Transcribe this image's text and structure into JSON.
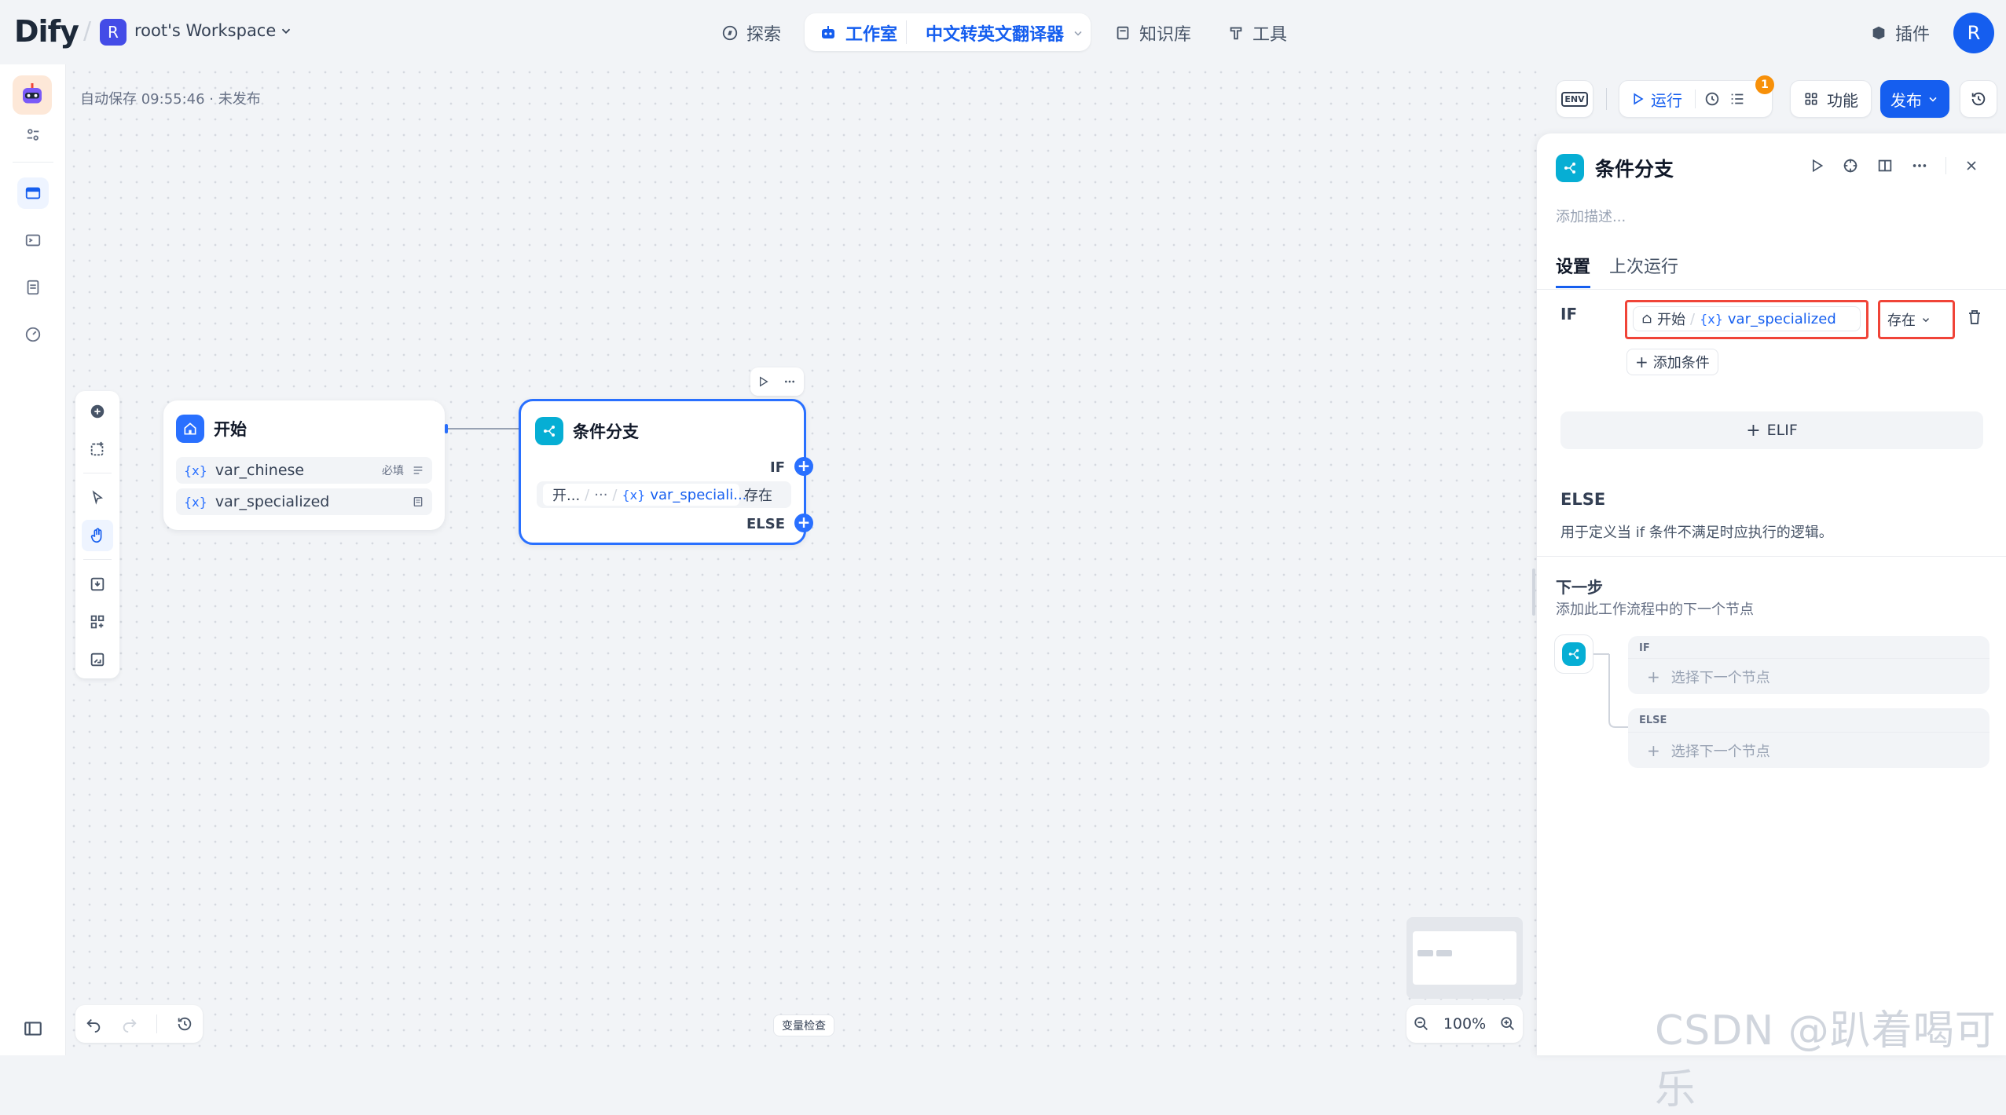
{
  "header": {
    "logo": "Dify",
    "workspace_initial": "R",
    "workspace_name": "root's Workspace",
    "nav": {
      "explore": "探索",
      "studio": "工作室",
      "app_name": "中文转英文翻译器",
      "knowledge": "知识库",
      "tools": "工具"
    },
    "plugins": "插件",
    "user_initial": "R"
  },
  "toolbar": {
    "autosave": "自动保存 09:55:46 · 未发布",
    "env": "ENV",
    "run": "运行",
    "badge_count": "1",
    "features": "功能",
    "publish": "发布"
  },
  "start_node": {
    "title": "开始",
    "vars": [
      {
        "name": "var_chinese",
        "tag": "必填"
      },
      {
        "name": "var_specialized",
        "tag": ""
      }
    ]
  },
  "if_node": {
    "title": "条件分支",
    "if_label": "IF",
    "else_label": "ELSE",
    "cond_source": "开...",
    "cond_ellipsis": "···",
    "cond_var": "var_speciali...",
    "cond_op": "存在"
  },
  "panel": {
    "title": "条件分支",
    "description_placeholder": "添加描述...",
    "tabs": {
      "settings": "设置",
      "last_run": "上次运行"
    },
    "if_label": "IF",
    "cond_node": "开始",
    "cond_var": "var_specialized",
    "cond_op": "存在",
    "add_condition": "添加条件",
    "elif": "ELIF",
    "else_title": "ELSE",
    "else_desc": "用于定义当 if 条件不满足时应执行的逻辑。",
    "next_title": "下一步",
    "next_desc": "添加此工作流程中的下一个节点",
    "branch_if": "IF",
    "branch_else": "ELSE",
    "select_next": "选择下一个节点"
  },
  "bottom": {
    "var_inspect": "变量检查",
    "zoom": "100%"
  },
  "watermark": "CSDN @趴着喝可乐"
}
